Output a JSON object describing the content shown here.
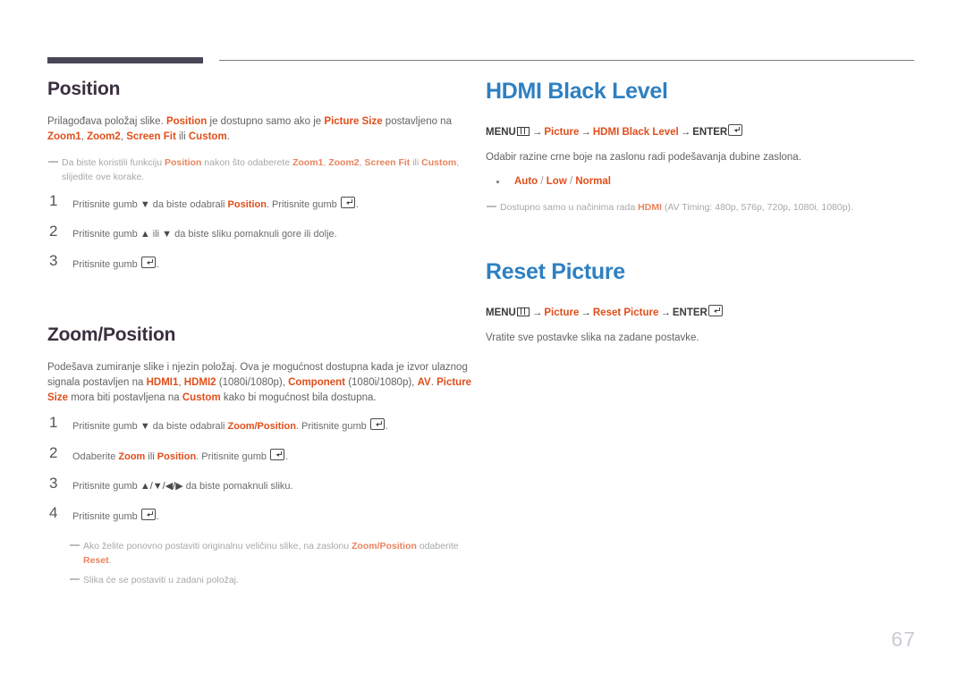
{
  "page": {
    "number": "67"
  },
  "header": {
    "thick_rule_color": "#4a4658",
    "thin_rule_color": "#7b7b80"
  },
  "colors": {
    "heading_blue": "#2e80c2",
    "heading_dark": "#3a2f3f",
    "accent_orange": "#e04e1b",
    "body_gray": "#636363",
    "note_gray": "#a8a8a8"
  },
  "left_column": {
    "position_section": {
      "heading": "Position",
      "intro": {
        "p1": "Prilagođava položaj slike. ",
        "hl1": "Position",
        "p2": " je dostupno samo ako je ",
        "hl2": "Picture Size",
        "p3": " postavljeno na ",
        "hl3": "Zoom1",
        "p4": ", ",
        "hl4": "Zoom2",
        "p5": ", ",
        "hl5": "Screen Fit",
        "p6": " ili ",
        "hl6": "Custom",
        "p7": "."
      },
      "note": {
        "t1": "Da biste koristili funkciju ",
        "hl1": "Position",
        "t2": " nakon što odaberete ",
        "hl2": "Zoom1",
        "t3": ", ",
        "hl3": "Zoom2",
        "t4": ", ",
        "hl4": "Screen Fit",
        "t5": " ili ",
        "hl5": "Custom",
        "t6": ", slijedite ove korake."
      },
      "steps": [
        {
          "num": "1",
          "t1": "Pritisnite gumb ",
          "sym1": "▼",
          "t2": " da biste odabrali ",
          "hl1": "Position",
          "t3": ". Pritisnite gumb ",
          "icon": "enter-icon",
          "t4": "."
        },
        {
          "num": "2",
          "t1": "Pritisnite gumb ",
          "sym1": "▲",
          "t2": " ili ",
          "sym2": "▼",
          "t3": " da biste sliku pomaknuli gore ili dolje.",
          "hl1": "",
          "t4": ""
        },
        {
          "num": "3",
          "t1": "Pritisnite gumb ",
          "icon": "enter-icon",
          "t4": "."
        }
      ]
    },
    "zoom_position_section": {
      "heading": "Zoom/Position",
      "intro": {
        "p1": "Podešava zumiranje slike i njezin položaj. Ova je mogućnost dostupna kada je izvor ulaznog signala postavljen na ",
        "hl1": "HDMI1",
        "p2": ", ",
        "hl2": "HDMI2",
        "p3": " (1080i/1080p), ",
        "hl3": "Component",
        "p4": " (1080i/1080p), ",
        "hl4": "AV",
        "p5": ". ",
        "hl5": "Picture Size",
        "p6": " mora biti postavljena na ",
        "hl6": "Custom",
        "p7": " kako bi mogućnost bila dostupna."
      },
      "steps": [
        {
          "num": "1",
          "t1": "Pritisnite gumb ",
          "sym1": "▼",
          "t2": " da biste odabrali ",
          "hl1": "Zoom/Position",
          "t3": ". Pritisnite gumb ",
          "icon": "enter-icon",
          "t4": "."
        },
        {
          "num": "2",
          "t1": "Odaberite ",
          "hl1": "Zoom",
          "t2": " ili ",
          "hl2": "Position",
          "t3": ". Pritisnite gumb ",
          "icon": "enter-icon",
          "t4": "."
        },
        {
          "num": "3",
          "t1": "Pritisnite gumb ",
          "sym1": "▲/▼/◀/▶",
          "t2": " da biste pomaknuli sliku.",
          "t4": ""
        },
        {
          "num": "4",
          "t1": "Pritisnite gumb ",
          "icon": "enter-icon",
          "t4": "."
        }
      ],
      "notes": [
        {
          "t1": "Ako želite ponovno postaviti originalnu veličinu slike, na zaslonu ",
          "hl1": "Zoom/Position",
          "t2": " odaberite ",
          "hl2": "Reset",
          "t3": "."
        },
        {
          "t1": "Slika će se postaviti u zadani položaj.",
          "hl1": "",
          "t2": "",
          "hl2": "",
          "t3": ""
        }
      ]
    }
  },
  "right_column": {
    "hdmi_black_level_section": {
      "heading": "HDMI Black Level",
      "menu_path": {
        "menu_label": "MENU",
        "menu_icon": "menu-icon",
        "arrow1": "→",
        "item1": "Picture",
        "arrow2": "→",
        "item2": "HDMI Black Level",
        "arrow3": "→",
        "enter_label": "ENTER",
        "enter_icon": "enter-icon"
      },
      "description": "Odabir razine crne boje na zaslonu radi podešavanja dubine zaslona.",
      "options": {
        "o1": "Auto",
        "sep1": " / ",
        "o2": "Low",
        "sep2": " / ",
        "o3": "Normal"
      },
      "note": {
        "t1": "Dostupno samo u načinima rada ",
        "hl1": "HDMI",
        "t2": " (AV Timing: 480p, 576p, 720p, 1080i, 1080p)."
      }
    },
    "reset_picture_section": {
      "heading": "Reset Picture",
      "menu_path": {
        "menu_label": "MENU",
        "menu_icon": "menu-icon",
        "arrow1": "→",
        "item1": "Picture",
        "arrow2": "→",
        "item2": "Reset Picture",
        "arrow3": "→",
        "enter_label": "ENTER",
        "enter_icon": "enter-icon"
      },
      "description": "Vratite sve postavke slika na zadane postavke."
    }
  }
}
